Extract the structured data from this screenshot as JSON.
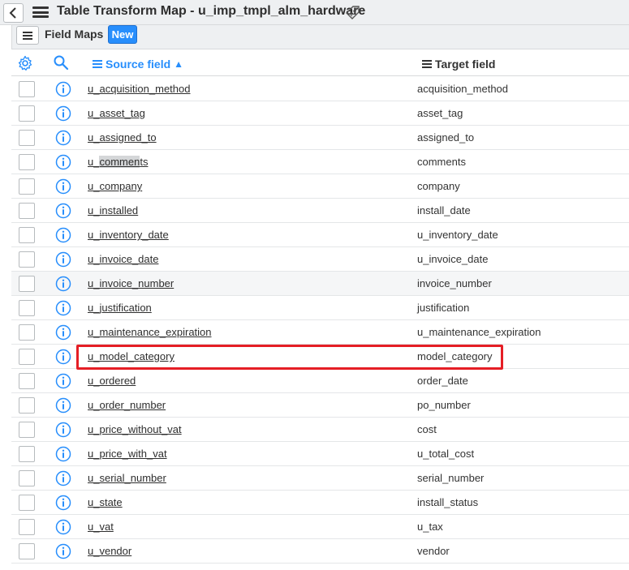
{
  "window": {
    "title": "Table Transform Map - u_imp_tmpl_alm_hardware",
    "back_icon": "chevron-left-icon",
    "menu_icon": "hamburger-icon",
    "tag_icon": "tag-icon"
  },
  "subheader": {
    "list_label": "Field Maps",
    "new_label": "New"
  },
  "columns": {
    "source": "Source field",
    "target": "Target field",
    "sort_indicator": "▲",
    "accent": "#278efc"
  },
  "rows": [
    {
      "source_pre": "u_",
      "source_mid": "",
      "source_post": "acquisition_method",
      "target": "acquisition_method"
    },
    {
      "source_pre": "u_",
      "source_mid": "",
      "source_post": "asset_tag",
      "target": "asset_tag"
    },
    {
      "source_pre": "u_",
      "source_mid": "",
      "source_post": "assigned_to",
      "target": "assigned_to"
    },
    {
      "source_pre": "u_",
      "source_mid": "commen",
      "source_post": "ts",
      "target": "comments"
    },
    {
      "source_pre": "u_",
      "source_mid": "",
      "source_post": "company",
      "target": "company"
    },
    {
      "source_pre": "u_",
      "source_mid": "",
      "source_post": "installed",
      "target": "install_date"
    },
    {
      "source_pre": "u_",
      "source_mid": "",
      "source_post": "inventory_date",
      "target": "u_inventory_date"
    },
    {
      "source_pre": "u_",
      "source_mid": "",
      "source_post": "invoice_date",
      "target": "u_invoice_date"
    },
    {
      "source_pre": "u_",
      "source_mid": "",
      "source_post": "invoice_number",
      "target": "invoice_number"
    },
    {
      "source_pre": "u_",
      "source_mid": "",
      "source_post": "justification",
      "target": "justification"
    },
    {
      "source_pre": "u_",
      "source_mid": "",
      "source_post": "maintenance_expiration",
      "target": "u_maintenance_expiration"
    },
    {
      "source_pre": "u_",
      "source_mid": "",
      "source_post": "model_category",
      "target": "model_category"
    },
    {
      "source_pre": "u_",
      "source_mid": "",
      "source_post": "ordered",
      "target": "order_date"
    },
    {
      "source_pre": "u_",
      "source_mid": "",
      "source_post": "order_number",
      "target": "po_number"
    },
    {
      "source_pre": "u_",
      "source_mid": "",
      "source_post": "price_without_vat",
      "target": "cost"
    },
    {
      "source_pre": "u_",
      "source_mid": "",
      "source_post": "price_with_vat",
      "target": "u_total_cost"
    },
    {
      "source_pre": "u_",
      "source_mid": "",
      "source_post": "serial_number",
      "target": "serial_number"
    },
    {
      "source_pre": "u_",
      "source_mid": "",
      "source_post": "state",
      "target": "install_status"
    },
    {
      "source_pre": "u_",
      "source_mid": "",
      "source_post": "vat",
      "target": "u_tax"
    },
    {
      "source_pre": "u_",
      "source_mid": "",
      "source_post": "vendor",
      "target": "vendor"
    }
  ],
  "highlighted_row_index": 11,
  "hovered_row_index": 8,
  "highlight_color": "#e51e25"
}
